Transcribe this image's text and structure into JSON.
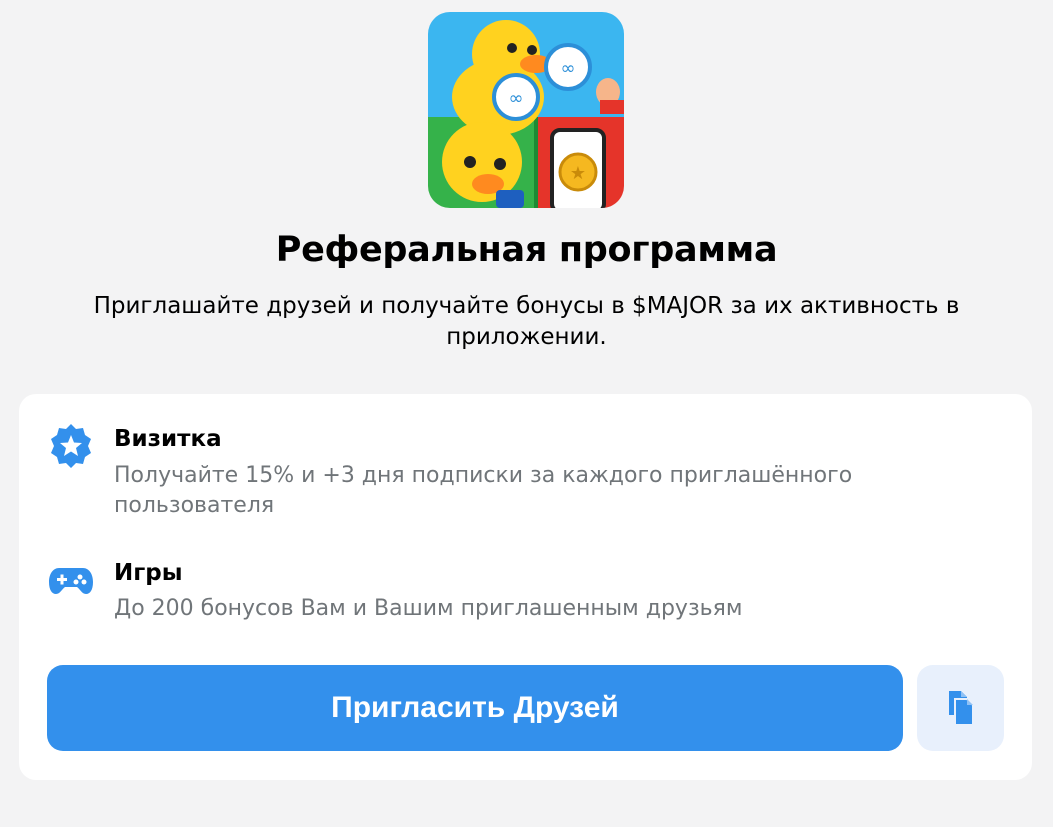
{
  "header": {
    "image_icon": "duck-referral-illustration",
    "title": "Реферальная программа",
    "subtitle": "Приглашайте друзей и получайте бонусы в $MAJOR за их активность в приложении."
  },
  "features": [
    {
      "icon": "star-badge-icon",
      "title": "Визитка",
      "description": "Получайте 15% и +3 дня подписки за каждого приглашённого пользователя"
    },
    {
      "icon": "gamepad-icon",
      "title": "Игры",
      "description": "До 200 бонусов Вам и Вашим приглашенным друзьям"
    }
  ],
  "actions": {
    "invite_label": "Пригласить Друзей",
    "copy_icon": "copy-icon"
  },
  "colors": {
    "accent": "#3390ec",
    "secondary_button_bg": "#e8f0fc",
    "muted_text": "#707579",
    "page_bg": "#f3f3f4"
  }
}
